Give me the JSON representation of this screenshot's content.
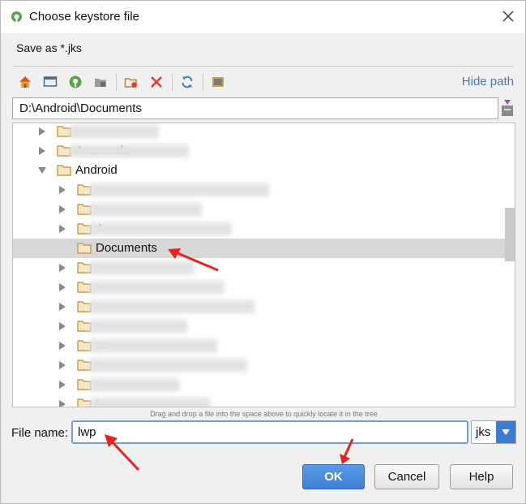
{
  "dialog": {
    "title": "Choose keystore file",
    "subtitle": "Save as *.jks",
    "close_glyph": "✕"
  },
  "toolbar": {
    "buttons": [
      {
        "name": "home-icon",
        "tooltip": "Home"
      },
      {
        "name": "desktop-icon",
        "tooltip": "Desktop"
      },
      {
        "name": "project-icon",
        "tooltip": "Project"
      },
      {
        "name": "module-icon",
        "tooltip": "Module"
      },
      {
        "name": "new-folder-icon",
        "tooltip": "New Folder"
      },
      {
        "name": "delete-icon",
        "tooltip": "Delete"
      },
      {
        "name": "refresh-icon",
        "tooltip": "Refresh"
      },
      {
        "name": "show-hidden-icon",
        "tooltip": "Show Hidden"
      }
    ],
    "hide_path_label": "Hide path"
  },
  "path": {
    "value": "D:\\Android\\Documents"
  },
  "tree": {
    "rows": [
      {
        "label": "",
        "depth": 1,
        "expanded": false,
        "selected": false,
        "obscured": true
      },
      {
        "label": "Anaconda",
        "depth": 1,
        "expanded": false,
        "selected": false,
        "obscured": true
      },
      {
        "label": "Android",
        "depth": 1,
        "expanded": true,
        "selected": false,
        "obscured": false
      },
      {
        "label": "",
        "depth": 2,
        "expanded": false,
        "selected": false,
        "obscured": true
      },
      {
        "label": "",
        "depth": 2,
        "expanded": false,
        "selected": false,
        "obscured": true
      },
      {
        "label": "A",
        "depth": 2,
        "expanded": false,
        "selected": false,
        "obscured": true
      },
      {
        "label": "Documents",
        "depth": 2,
        "expanded": false,
        "selected": true,
        "obscured": false,
        "leaf": true
      },
      {
        "label": "",
        "depth": 2,
        "expanded": false,
        "selected": false,
        "obscured": true
      },
      {
        "label": "",
        "depth": 2,
        "expanded": false,
        "selected": false,
        "obscured": true
      },
      {
        "label": "",
        "depth": 2,
        "expanded": false,
        "selected": false,
        "obscured": true
      },
      {
        "label": "",
        "depth": 2,
        "expanded": false,
        "selected": false,
        "obscured": true
      },
      {
        "label": "se",
        "depth": 2,
        "expanded": false,
        "selected": false,
        "obscured": true
      },
      {
        "label": "",
        "depth": 2,
        "expanded": false,
        "selected": false,
        "obscured": true
      },
      {
        "label": "",
        "depth": 2,
        "expanded": false,
        "selected": false,
        "obscured": true
      },
      {
        "label": "t",
        "depth": 2,
        "expanded": false,
        "selected": false,
        "obscured": true
      }
    ]
  },
  "hint": "Drag and drop a file into the space above to quickly locate it in the tree",
  "file_name": {
    "label": "File name:",
    "value": "lwp",
    "extension": "jks"
  },
  "buttons": {
    "ok": "OK",
    "cancel": "Cancel",
    "help": "Help"
  },
  "colors": {
    "accent": "#3d7fd6",
    "link": "#4a78b0",
    "selection": "#d7d7d7",
    "annotation": "#e8231e",
    "folder": "#c89a4a"
  }
}
